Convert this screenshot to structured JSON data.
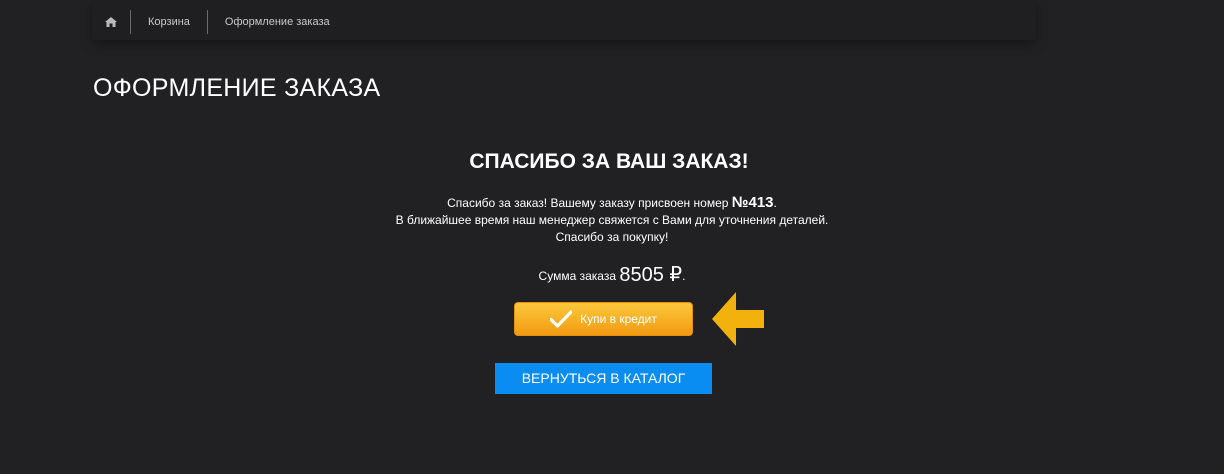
{
  "breadcrumb": {
    "home_icon": "home-icon",
    "items": [
      {
        "label": "Корзина"
      },
      {
        "label": "Оформление заказа"
      }
    ]
  },
  "page": {
    "title": "ОФОРМЛЕНИЕ ЗАКАЗА"
  },
  "confirmation": {
    "heading": "СПАСИБО ЗА ВАШ ЗАКАЗ!",
    "line1_prefix": "Спасибо за заказ! Вашему заказу присвоен номер ",
    "order_number": "№413",
    "line1_suffix": ".",
    "line2": "В ближайшее время наш менеджер свяжется с Вами для уточнения деталей.",
    "line3": "Спасибо за покупку!",
    "sum_label": "Сумма заказа ",
    "sum_amount": "8505 ₽",
    "sum_suffix": "."
  },
  "credit_button": {
    "label": "Купи в кредит",
    "icon": "checkmark-icon",
    "pointer_icon": "arrow-left-icon"
  },
  "catalog_button": {
    "label": "ВЕРНУТЬСЯ В КАТАЛОГ"
  },
  "colors": {
    "background": "#212023",
    "credit_button": "#f7b025",
    "catalog_button": "#0a8df3",
    "arrow": "#f3b10e"
  }
}
